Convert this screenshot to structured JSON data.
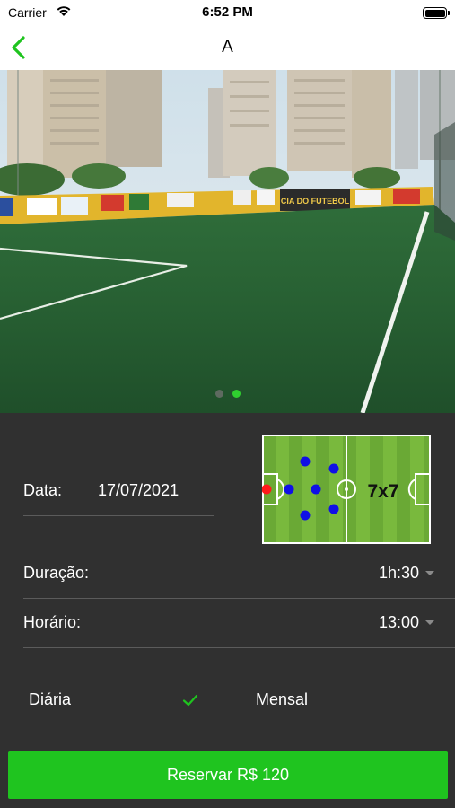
{
  "status_bar": {
    "carrier": "Carrier",
    "time": "6:52 PM"
  },
  "nav": {
    "title": "A",
    "back_icon": "chevron-left-icon"
  },
  "gallery": {
    "page_count": 2,
    "current_page": 2,
    "banner_text": "CIA DO FUTEBOL"
  },
  "booking": {
    "date_label": "Data:",
    "date_value": "17/07/2021",
    "duration_label": "Duração:",
    "duration_value": "1h:30",
    "time_label": "Horário:",
    "time_value": "13:00",
    "field_format": "7x7",
    "option_daily": "Diária",
    "option_monthly": "Mensal",
    "selected_option": "Diária"
  },
  "action": {
    "reserve_label": "Reservar R$ 120"
  },
  "colors": {
    "accent_green": "#1fc41f",
    "panel_background": "#303030",
    "navbar_background": "#ffffff"
  }
}
